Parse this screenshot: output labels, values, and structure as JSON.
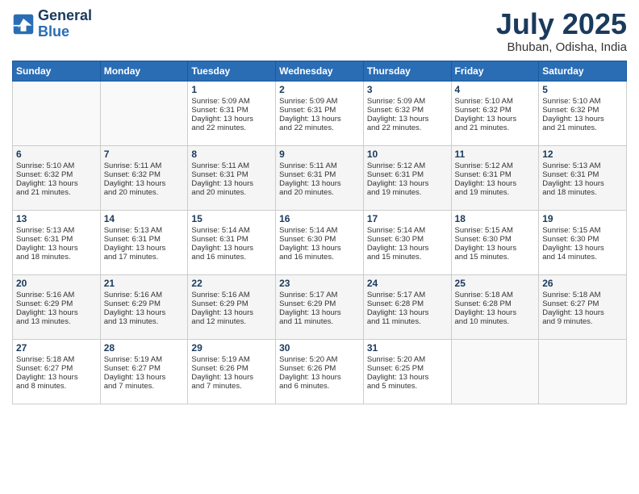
{
  "logo": {
    "line1": "General",
    "line2": "Blue"
  },
  "title": "July 2025",
  "location": "Bhuban, Odisha, India",
  "weekdays": [
    "Sunday",
    "Monday",
    "Tuesday",
    "Wednesday",
    "Thursday",
    "Friday",
    "Saturday"
  ],
  "weeks": [
    [
      {
        "day": "",
        "content": ""
      },
      {
        "day": "",
        "content": ""
      },
      {
        "day": "1",
        "content": "Sunrise: 5:09 AM\nSunset: 6:31 PM\nDaylight: 13 hours\nand 22 minutes."
      },
      {
        "day": "2",
        "content": "Sunrise: 5:09 AM\nSunset: 6:31 PM\nDaylight: 13 hours\nand 22 minutes."
      },
      {
        "day": "3",
        "content": "Sunrise: 5:09 AM\nSunset: 6:32 PM\nDaylight: 13 hours\nand 22 minutes."
      },
      {
        "day": "4",
        "content": "Sunrise: 5:10 AM\nSunset: 6:32 PM\nDaylight: 13 hours\nand 21 minutes."
      },
      {
        "day": "5",
        "content": "Sunrise: 5:10 AM\nSunset: 6:32 PM\nDaylight: 13 hours\nand 21 minutes."
      }
    ],
    [
      {
        "day": "6",
        "content": "Sunrise: 5:10 AM\nSunset: 6:32 PM\nDaylight: 13 hours\nand 21 minutes."
      },
      {
        "day": "7",
        "content": "Sunrise: 5:11 AM\nSunset: 6:32 PM\nDaylight: 13 hours\nand 20 minutes."
      },
      {
        "day": "8",
        "content": "Sunrise: 5:11 AM\nSunset: 6:31 PM\nDaylight: 13 hours\nand 20 minutes."
      },
      {
        "day": "9",
        "content": "Sunrise: 5:11 AM\nSunset: 6:31 PM\nDaylight: 13 hours\nand 20 minutes."
      },
      {
        "day": "10",
        "content": "Sunrise: 5:12 AM\nSunset: 6:31 PM\nDaylight: 13 hours\nand 19 minutes."
      },
      {
        "day": "11",
        "content": "Sunrise: 5:12 AM\nSunset: 6:31 PM\nDaylight: 13 hours\nand 19 minutes."
      },
      {
        "day": "12",
        "content": "Sunrise: 5:13 AM\nSunset: 6:31 PM\nDaylight: 13 hours\nand 18 minutes."
      }
    ],
    [
      {
        "day": "13",
        "content": "Sunrise: 5:13 AM\nSunset: 6:31 PM\nDaylight: 13 hours\nand 18 minutes."
      },
      {
        "day": "14",
        "content": "Sunrise: 5:13 AM\nSunset: 6:31 PM\nDaylight: 13 hours\nand 17 minutes."
      },
      {
        "day": "15",
        "content": "Sunrise: 5:14 AM\nSunset: 6:31 PM\nDaylight: 13 hours\nand 16 minutes."
      },
      {
        "day": "16",
        "content": "Sunrise: 5:14 AM\nSunset: 6:30 PM\nDaylight: 13 hours\nand 16 minutes."
      },
      {
        "day": "17",
        "content": "Sunrise: 5:14 AM\nSunset: 6:30 PM\nDaylight: 13 hours\nand 15 minutes."
      },
      {
        "day": "18",
        "content": "Sunrise: 5:15 AM\nSunset: 6:30 PM\nDaylight: 13 hours\nand 15 minutes."
      },
      {
        "day": "19",
        "content": "Sunrise: 5:15 AM\nSunset: 6:30 PM\nDaylight: 13 hours\nand 14 minutes."
      }
    ],
    [
      {
        "day": "20",
        "content": "Sunrise: 5:16 AM\nSunset: 6:29 PM\nDaylight: 13 hours\nand 13 minutes."
      },
      {
        "day": "21",
        "content": "Sunrise: 5:16 AM\nSunset: 6:29 PM\nDaylight: 13 hours\nand 13 minutes."
      },
      {
        "day": "22",
        "content": "Sunrise: 5:16 AM\nSunset: 6:29 PM\nDaylight: 13 hours\nand 12 minutes."
      },
      {
        "day": "23",
        "content": "Sunrise: 5:17 AM\nSunset: 6:29 PM\nDaylight: 13 hours\nand 11 minutes."
      },
      {
        "day": "24",
        "content": "Sunrise: 5:17 AM\nSunset: 6:28 PM\nDaylight: 13 hours\nand 11 minutes."
      },
      {
        "day": "25",
        "content": "Sunrise: 5:18 AM\nSunset: 6:28 PM\nDaylight: 13 hours\nand 10 minutes."
      },
      {
        "day": "26",
        "content": "Sunrise: 5:18 AM\nSunset: 6:27 PM\nDaylight: 13 hours\nand 9 minutes."
      }
    ],
    [
      {
        "day": "27",
        "content": "Sunrise: 5:18 AM\nSunset: 6:27 PM\nDaylight: 13 hours\nand 8 minutes."
      },
      {
        "day": "28",
        "content": "Sunrise: 5:19 AM\nSunset: 6:27 PM\nDaylight: 13 hours\nand 7 minutes."
      },
      {
        "day": "29",
        "content": "Sunrise: 5:19 AM\nSunset: 6:26 PM\nDaylight: 13 hours\nand 7 minutes."
      },
      {
        "day": "30",
        "content": "Sunrise: 5:20 AM\nSunset: 6:26 PM\nDaylight: 13 hours\nand 6 minutes."
      },
      {
        "day": "31",
        "content": "Sunrise: 5:20 AM\nSunset: 6:25 PM\nDaylight: 13 hours\nand 5 minutes."
      },
      {
        "day": "",
        "content": ""
      },
      {
        "day": "",
        "content": ""
      }
    ]
  ]
}
